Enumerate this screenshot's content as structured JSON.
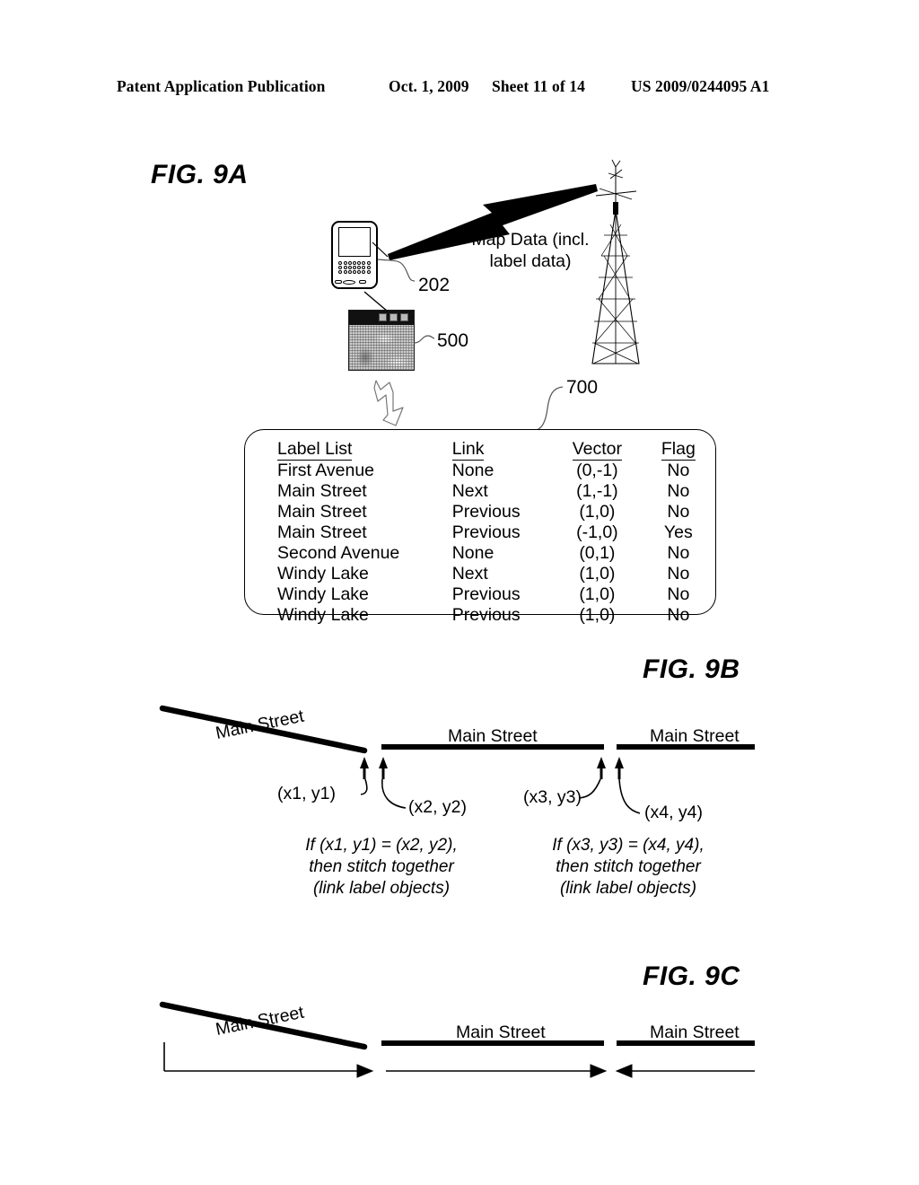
{
  "header": {
    "publication": "Patent Application Publication",
    "date": "Oct. 1, 2009",
    "sheet": "Sheet 11 of 14",
    "patent_number": "US 2009/0244095 A1"
  },
  "figures": {
    "fig_9a": {
      "title": "FIG. 9A",
      "transmission_label": "Map Data (incl.\nlabel data)",
      "transmission_line1": "Map Data (incl.",
      "transmission_line2": "label data)",
      "ref_device": "202",
      "ref_map_window": "500",
      "ref_table": "700",
      "table": {
        "columns": [
          "Label List",
          "Link",
          "Vector",
          "Flag"
        ],
        "rows": [
          {
            "label": "First Avenue",
            "link": "None",
            "vector": "(0,-1)",
            "flag": "No"
          },
          {
            "label": "Main Street",
            "link": "Next",
            "vector": "(1,-1)",
            "flag": "No"
          },
          {
            "label": "Main Street",
            "link": "Previous",
            "vector": "(1,0)",
            "flag": "No"
          },
          {
            "label": "Main Street",
            "link": "Previous",
            "vector": "(-1,0)",
            "flag": "Yes"
          },
          {
            "label": "Second Avenue",
            "link": "None",
            "vector": "(0,1)",
            "flag": "No"
          },
          {
            "label": "Windy Lake",
            "link": "Next",
            "vector": "(1,0)",
            "flag": "No"
          },
          {
            "label": "Windy Lake",
            "link": "Previous",
            "vector": "(1,0)",
            "flag": "No"
          },
          {
            "label": "Windy Lake",
            "link": "Previous",
            "vector": "(1,0)",
            "flag": "No"
          }
        ]
      }
    },
    "fig_9b": {
      "title": "FIG. 9B",
      "street_labels": [
        "Main Street",
        "Main Street",
        "Main Street"
      ],
      "coords": [
        "(x1, y1)",
        "(x2, y2)",
        "(x3, y3)",
        "(x4, y4)"
      ],
      "caption_left": {
        "line1": "If (x1, y1) = (x2, y2),",
        "line2": "then stitch together",
        "line3": "(link label objects)"
      },
      "caption_right": {
        "line1": "If (x3, y3) = (x4, y4),",
        "line2": "then stitch together",
        "line3": "(link label objects)"
      }
    },
    "fig_9c": {
      "title": "FIG. 9C",
      "street_labels": [
        "Main Street",
        "Main Street",
        "Main Street"
      ]
    }
  },
  "colors": {
    "ink": "#000000",
    "paper": "#ffffff",
    "window_titlebar": "#111111",
    "window_button": "#b9b9b9",
    "map_fill": "#cccccc"
  }
}
